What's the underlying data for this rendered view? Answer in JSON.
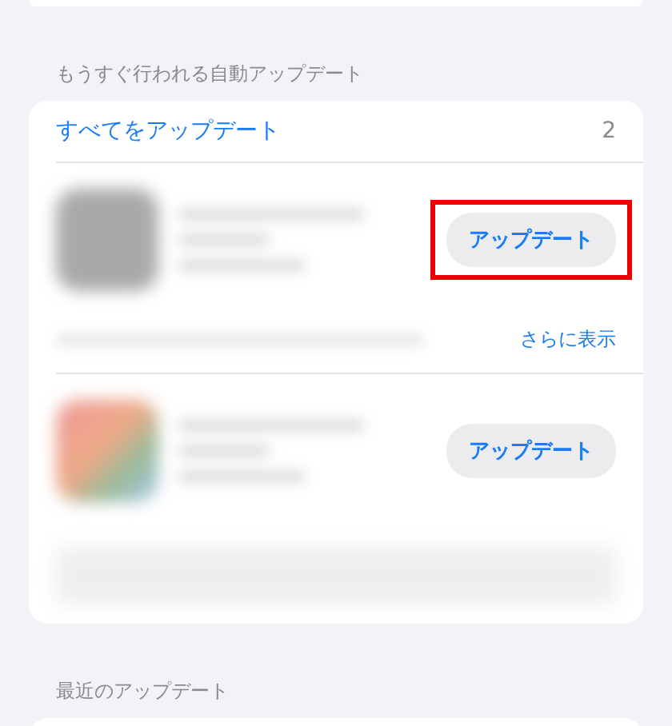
{
  "auto_updates": {
    "header": "もうすぐ行われる自動アップデート",
    "update_all": {
      "label": "すべてをアップデート",
      "count": "2"
    },
    "apps": [
      {
        "kind": "expanded",
        "button": "アップデート",
        "highlighted": true,
        "more": "さらに表示"
      },
      {
        "kind": "collapsed",
        "button": "アップデート",
        "highlighted": false
      }
    ]
  },
  "recent_updates": {
    "header": "最近のアップデート"
  }
}
